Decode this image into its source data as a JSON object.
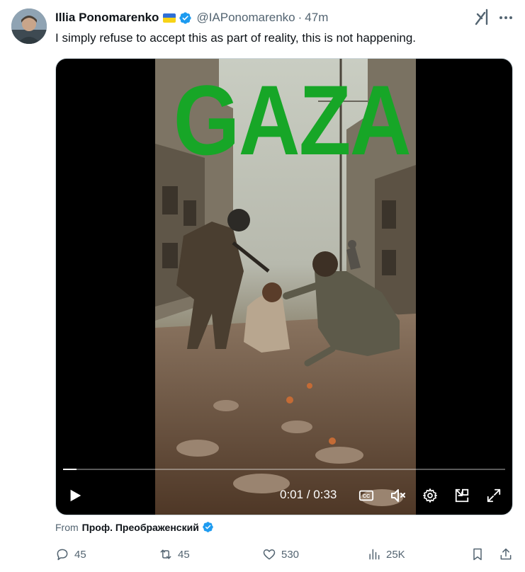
{
  "tweet": {
    "display_name": "Illia Ponomarenko",
    "handle": "@IAPonomarenko",
    "separator": "·",
    "time": "47m",
    "text": "I simply refuse to accept this as part of reality, this is not happening."
  },
  "media": {
    "overlay_text": "GAZA",
    "overlay_color": "#17a627",
    "current_time": "0:01",
    "duration": "0:33",
    "time_separator": " / ",
    "progress_fraction": 0.03
  },
  "source": {
    "prefix": "From",
    "name": "Проф. Преображенский"
  },
  "actions": {
    "replies": "45",
    "reposts": "45",
    "likes": "530",
    "views": "25K"
  },
  "colors": {
    "verified": "#1d9bf0",
    "muted": "#536471",
    "text": "#0f1419"
  }
}
